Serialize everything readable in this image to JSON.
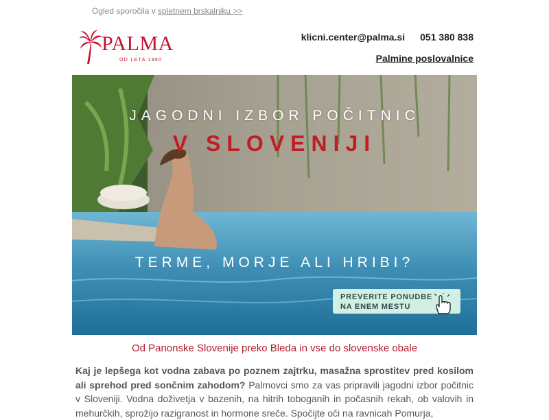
{
  "header": {
    "view_text": "Ogled sporočila v ",
    "view_link": "spletnem brskalniku >>",
    "email": "klicni.center@palma.si",
    "phone": "051 380 838",
    "branches_link": "Palmine poslovalnice"
  },
  "logo": {
    "word": "PALMA",
    "tagline": "OD LETA 1990",
    "icon": "palm-tree-icon"
  },
  "hero": {
    "line1": "JAGODNI IZBOR POČITNIC",
    "line2": "V SLOVENIJI",
    "line3": "TERME, MORJE ALI HRIBI?",
    "cta_line1": "PREVERITE PONUDBE",
    "cta_line2": "NA ENEM MESTU",
    "cta_icon": "pointer-hand-icon"
  },
  "content": {
    "subtitle": "Od Panonske Slovenije preko Bleda in vse do slovenske obale",
    "intro_bold": "Kaj je lepšega kot vodna zabava po poznem zajtrku, masažna sprostitev pred kosilom ali sprehod pred sončnim zahodom?",
    "intro_text": " Palmovci smo za vas pripravili jagodni izbor počitnic v Sloveniji. Vodna doživetja v bazenih, na hitrih toboganih in počasnih rekah, ob valovih in mehurčkih, sprožijo razigranost in hormone sreče. Spočijte oči na ravnicah Pomurja,"
  },
  "colors": {
    "brand_red": "#c8102e",
    "cta_bg": "#d2efe6",
    "water": "#3f8fb5"
  }
}
